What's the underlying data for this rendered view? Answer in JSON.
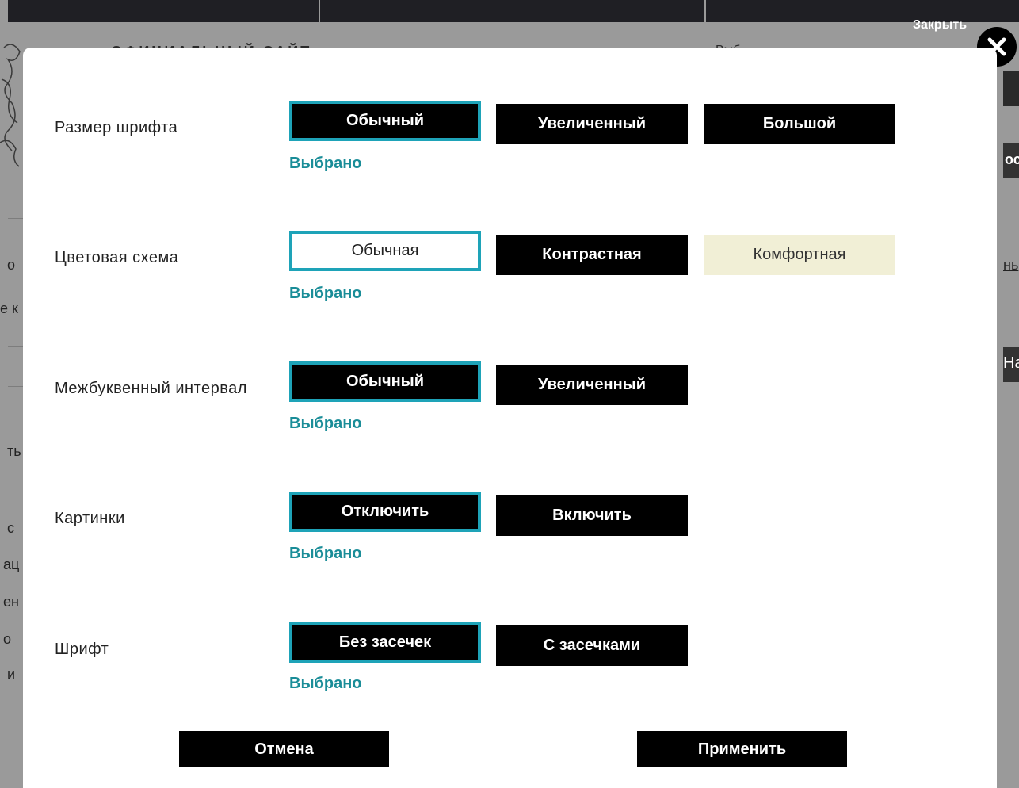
{
  "background": {
    "header_text": "ОФИЦИАЛЬНЫЙ САЙТ",
    "header_right_text": "Выб",
    "fragments": [
      "о",
      "е к",
      "ть",
      "с",
      "ац",
      "ен",
      "о",
      "и",
      "ос",
      "нь",
      "На"
    ]
  },
  "close": {
    "label": "Закрыть"
  },
  "settings": [
    {
      "label": "Размер шрифта",
      "options": [
        "Обычный",
        "Увеличенный",
        "Большой"
      ],
      "selected_note": "Выбрано"
    },
    {
      "label": "Цветовая схема",
      "options": [
        "Обычная",
        "Контрастная",
        "Комфортная"
      ],
      "selected_note": "Выбрано"
    },
    {
      "label": "Межбуквенный интервал",
      "options": [
        "Обычный",
        "Увеличенный"
      ],
      "selected_note": "Выбрано"
    },
    {
      "label": "Картинки",
      "options": [
        "Отключить",
        "Включить"
      ],
      "selected_note": "Выбрано"
    },
    {
      "label": "Шрифт",
      "options": [
        "Без засечек",
        "С засечками"
      ],
      "selected_note": "Выбрано"
    }
  ],
  "actions": {
    "cancel": "Отмена",
    "apply": "Применить"
  },
  "colors": {
    "accent": "#1ea3b8",
    "selected_text": "#1a8d98",
    "button_bg": "#000000",
    "cream": "#f1efd6"
  }
}
